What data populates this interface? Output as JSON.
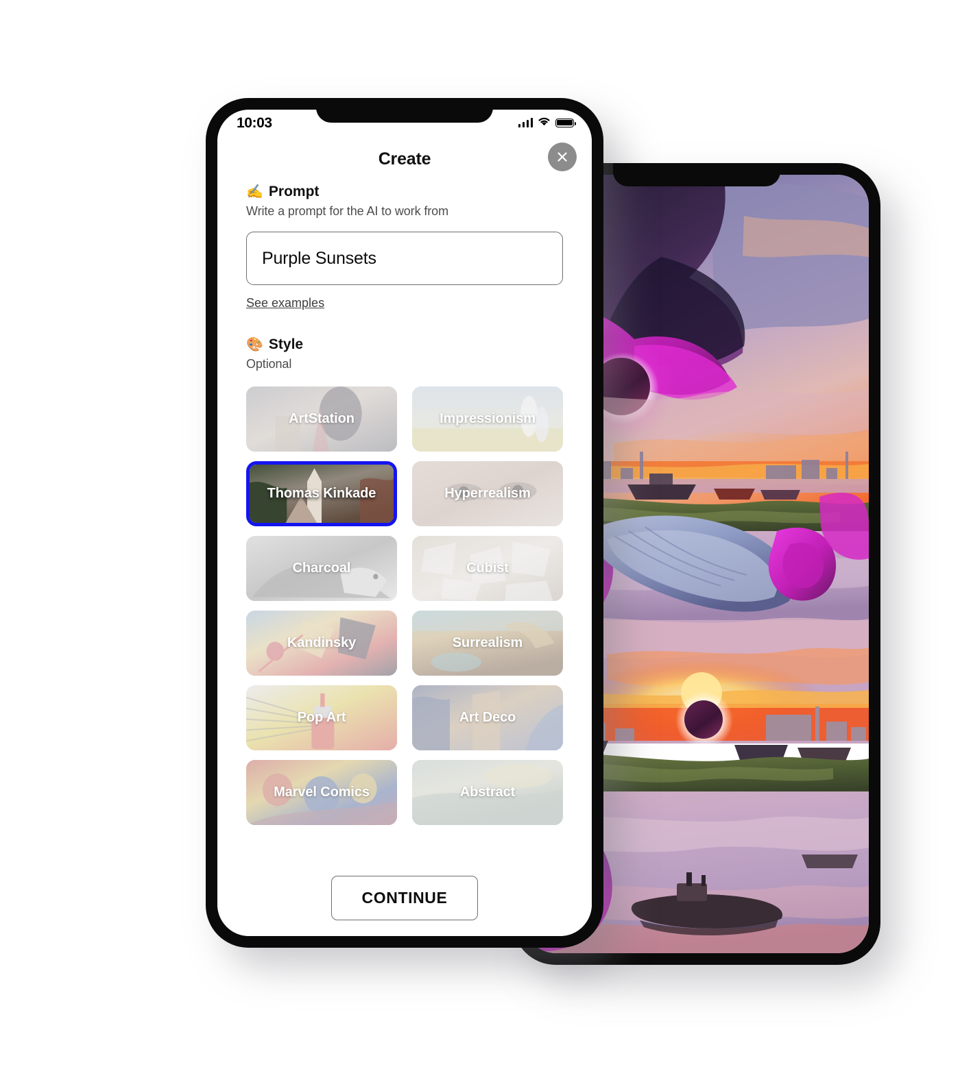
{
  "left_phone": {
    "status_bar": {
      "time": "10:03",
      "signal_icon": "cellular-bars-icon",
      "wifi_icon": "wifi-icon",
      "battery_icon": "battery-full-icon"
    },
    "header": {
      "title": "Create",
      "close_label": "close-icon"
    },
    "prompt_section": {
      "emoji": "✍️",
      "title": "Prompt",
      "subtitle": "Write a prompt for the AI to work from",
      "input_value": "Purple Sunsets",
      "input_placeholder": "Write a prompt for the AI to work from",
      "examples_link": "See examples"
    },
    "style_section": {
      "emoji": "🎨",
      "title": "Style",
      "subtitle": "Optional",
      "selected": "Thomas Kinkade",
      "selected_color": "#1414f0",
      "cards": [
        {
          "label": "ArtStation",
          "selected": false
        },
        {
          "label": "Impressionism",
          "selected": false
        },
        {
          "label": "Thomas Kinkade",
          "selected": true
        },
        {
          "label": "Hyperrealism",
          "selected": false
        },
        {
          "label": "Charcoal",
          "selected": false
        },
        {
          "label": "Cubist",
          "selected": false
        },
        {
          "label": "Kandinsky",
          "selected": false
        },
        {
          "label": "Surrealism",
          "selected": false
        },
        {
          "label": "Pop Art",
          "selected": false
        },
        {
          "label": "Art Deco",
          "selected": false
        },
        {
          "label": "Marvel Comics",
          "selected": false
        },
        {
          "label": "Abstract",
          "selected": false
        }
      ]
    },
    "footer": {
      "continue_label": "CONTINUE"
    }
  },
  "right_phone": {
    "artwork_description": "AI generated purple sunset riverscape with magenta clouds, eclipse orbs, boats and draped purple fabric",
    "palette": {
      "sky_purple": "#7c6fa8",
      "magenta": "#cf2ac4",
      "deep_violet": "#2e1f3f",
      "sunset_orange": "#f2682b",
      "sunset_yellow": "#f8c34a",
      "water_mauve": "#c6a7c2",
      "drape_blue": "#8e9bc4",
      "bank_olive": "#5d6b3b"
    }
  }
}
